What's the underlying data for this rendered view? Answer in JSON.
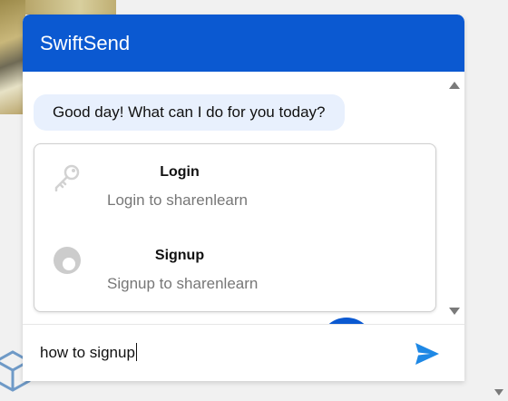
{
  "chat": {
    "title": "SwiftSend",
    "bot_message": "Good day! What can I do for you today?",
    "options": [
      {
        "icon": "key-icon",
        "title": "Login",
        "subtitle": "Login to sharenlearn"
      },
      {
        "icon": "user-avatar-icon",
        "title": "Signup",
        "subtitle": "Signup to sharenlearn"
      }
    ],
    "input": {
      "value": "how to signup"
    },
    "send_icon": "send-icon"
  },
  "colors": {
    "header": "#0b59d1",
    "bubble": "#e8f0fd",
    "send": "#1e88e5"
  }
}
